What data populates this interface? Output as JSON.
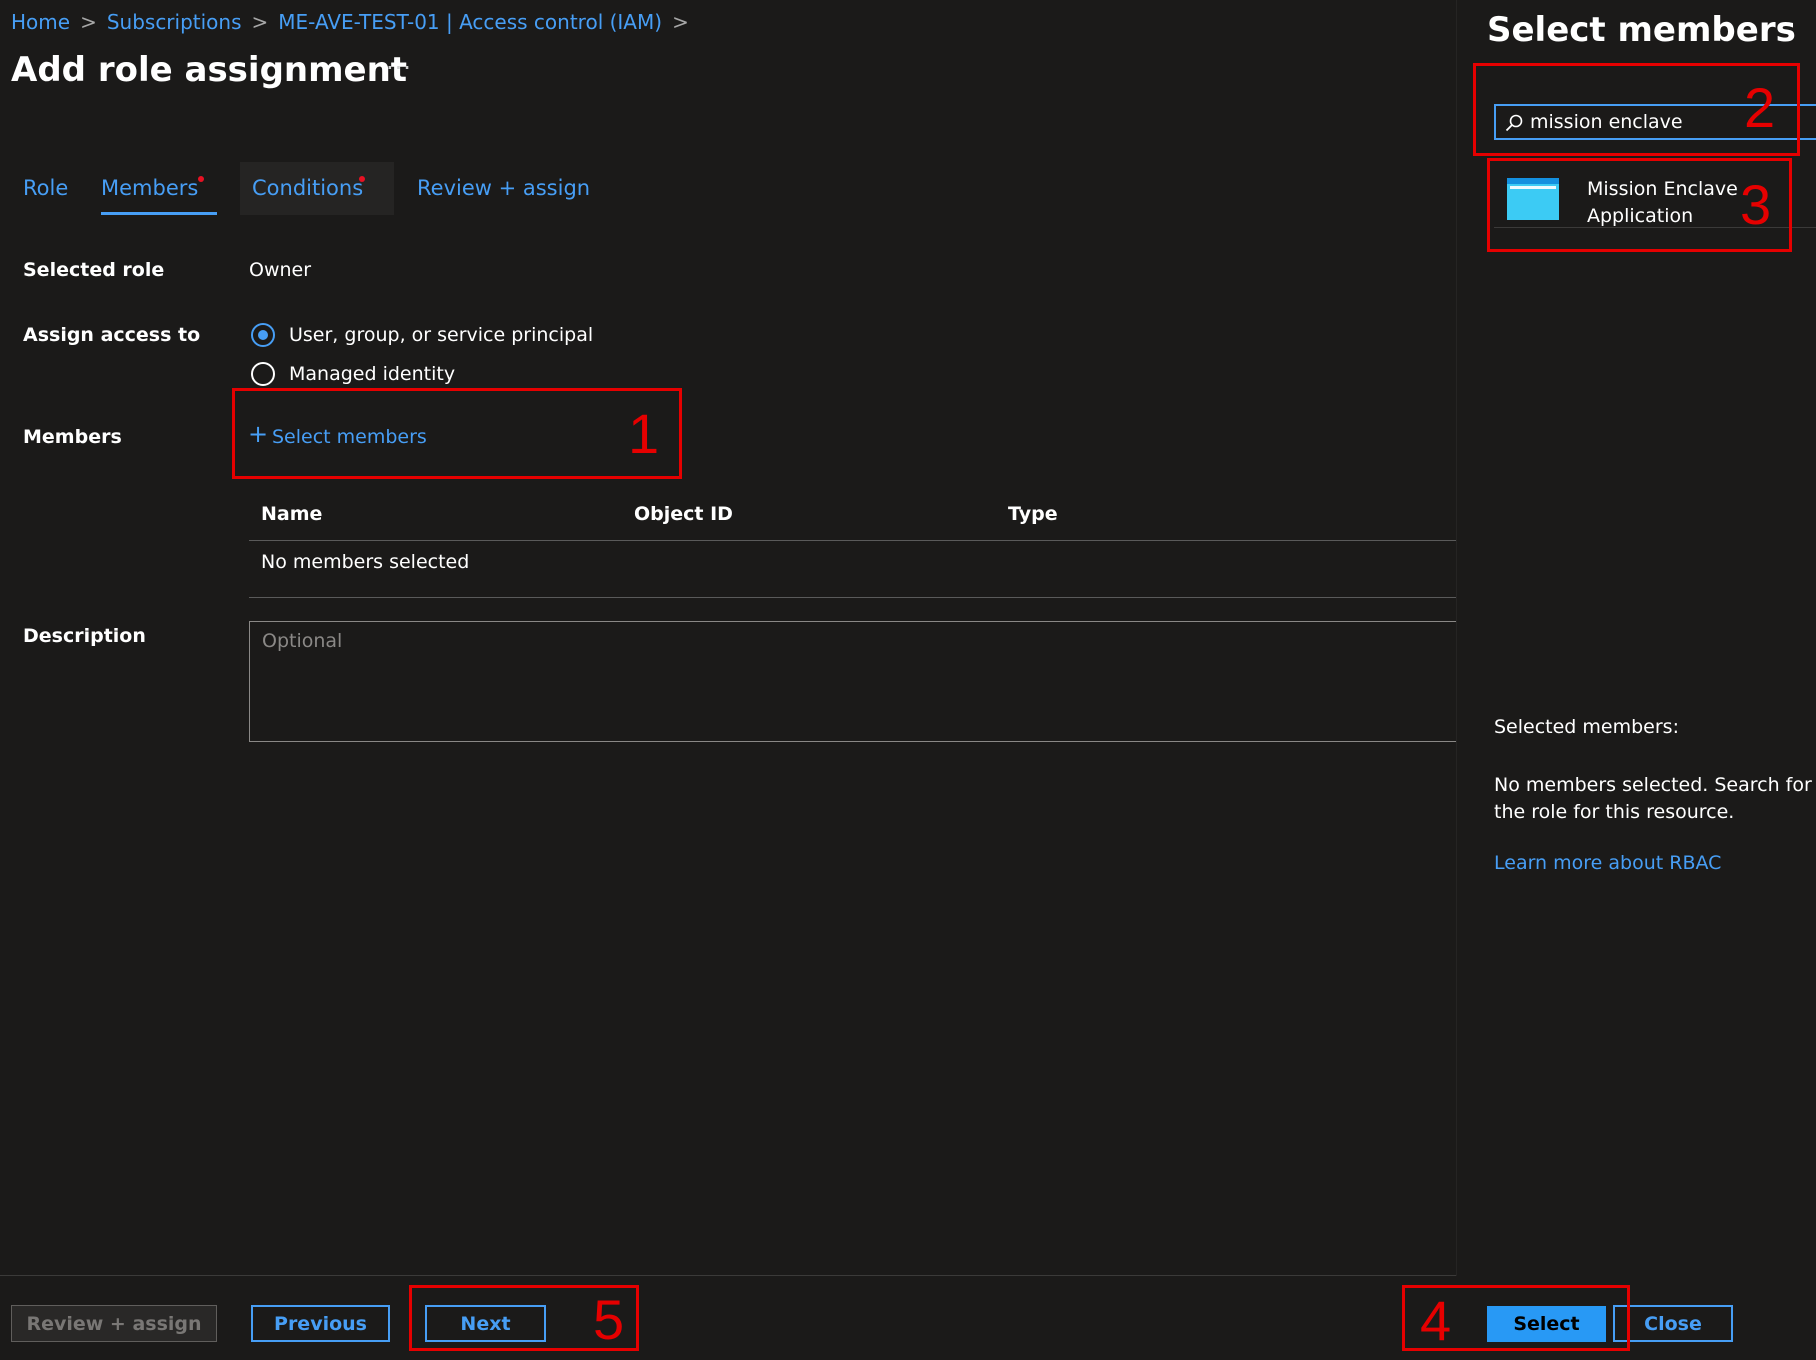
{
  "breadcrumb": {
    "items": [
      "Home",
      "Subscriptions",
      "ME-AVE-TEST-01 | Access control (IAM)"
    ],
    "separator": ">"
  },
  "page": {
    "title": "Add role assignment",
    "more": "···"
  },
  "tabs": [
    {
      "label": "Role",
      "required": false
    },
    {
      "label": "Members",
      "required": true,
      "selected": true
    },
    {
      "label": "Conditions",
      "required": true
    },
    {
      "label": "Review + assign",
      "required": false
    }
  ],
  "form": {
    "selected_role": {
      "label": "Selected role",
      "value": "Owner"
    },
    "assign_access": {
      "label": "Assign access to",
      "options": [
        "User, group, or service principal",
        "Managed identity"
      ],
      "selected": "User, group, or service principal"
    },
    "members": {
      "label": "Members",
      "select_link": "Select members",
      "columns": [
        "Name",
        "Object ID",
        "Type"
      ],
      "empty_text": "No members selected"
    },
    "description": {
      "label": "Description",
      "placeholder": "Optional"
    }
  },
  "annotations": [
    "1",
    "2",
    "3",
    "4",
    "5"
  ],
  "footer": {
    "review_assign": "Review + assign",
    "previous": "Previous",
    "next": "Next"
  },
  "panel": {
    "title": "Select members",
    "search_value": "mission enclave",
    "result": {
      "name_line1": "Mission Enclave",
      "name_line2": "Application",
      "icon": "app-registration-icon"
    },
    "selected_label": "Selected members:",
    "empty_line1": "No members selected. Search for and",
    "empty_line2": "the role for this resource.",
    "learn_more": "Learn more about RBAC",
    "select_button": "Select",
    "close_button": "Close"
  },
  "colors": {
    "accent": "#479ef5",
    "annotation_red": "#e60000",
    "background": "#1b1a19"
  }
}
